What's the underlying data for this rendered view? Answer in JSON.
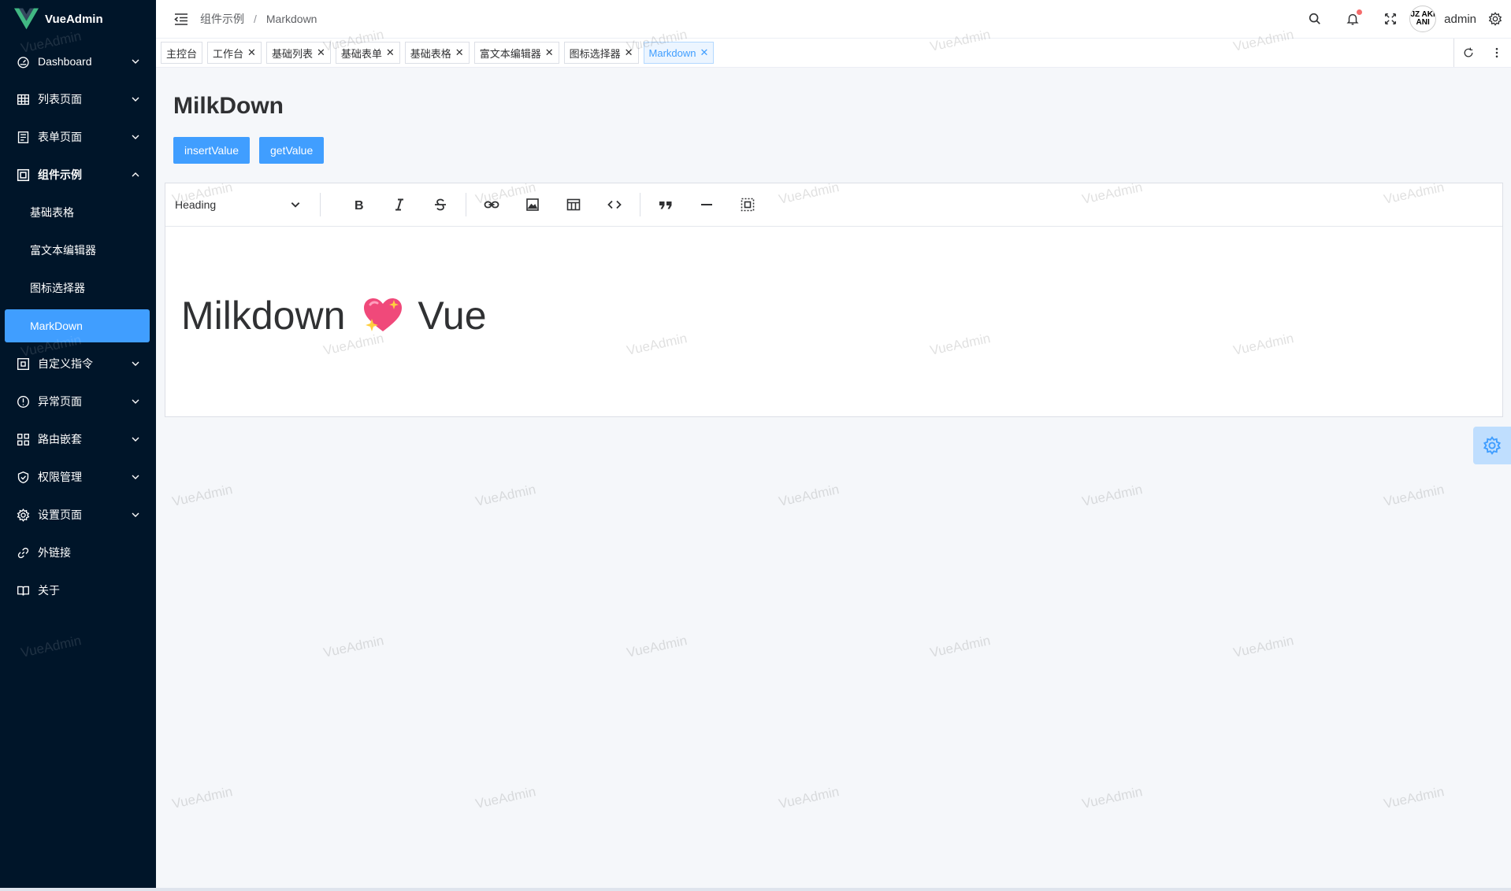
{
  "app": {
    "name": "VueAdmin",
    "brand_color": "#41b883",
    "accent": "#409eff",
    "sidebar_bg": "#001529"
  },
  "sidebar": {
    "items": [
      {
        "label": "Dashboard",
        "icon": "dashboard-icon",
        "has_children": true
      },
      {
        "label": "列表页面",
        "icon": "table-icon",
        "has_children": true
      },
      {
        "label": "表单页面",
        "icon": "form-icon",
        "has_children": true
      },
      {
        "label": "组件示例",
        "icon": "component-icon",
        "has_children": true,
        "open": true,
        "children": [
          {
            "label": "基础表格"
          },
          {
            "label": "富文本编辑器"
          },
          {
            "label": "图标选择器"
          },
          {
            "label": "MarkDown",
            "active": true
          }
        ]
      },
      {
        "label": "自定义指令",
        "icon": "command-icon",
        "has_children": true
      },
      {
        "label": "异常页面",
        "icon": "warning-icon",
        "has_children": true
      },
      {
        "label": "路由嵌套",
        "icon": "route-icon",
        "has_children": true
      },
      {
        "label": "权限管理",
        "icon": "shield-icon",
        "has_children": true
      },
      {
        "label": "设置页面",
        "icon": "gear-icon",
        "has_children": true
      },
      {
        "label": "外链接",
        "icon": "link-icon",
        "has_children": false
      },
      {
        "label": "关于",
        "icon": "book-icon",
        "has_children": false
      }
    ]
  },
  "header": {
    "breadcrumb": [
      "组件示例",
      "Markdown"
    ],
    "separator": "/",
    "username": "admin",
    "avatar_text": "JZ AKI ANI"
  },
  "tags": [
    {
      "label": "主控台",
      "closable": false
    },
    {
      "label": "工作台",
      "closable": true
    },
    {
      "label": "基础列表",
      "closable": true
    },
    {
      "label": "基础表单",
      "closable": true
    },
    {
      "label": "基础表格",
      "closable": true
    },
    {
      "label": "富文本编辑器",
      "closable": true
    },
    {
      "label": "图标选择器",
      "closable": true
    },
    {
      "label": "Markdown",
      "closable": true,
      "active": true
    }
  ],
  "page": {
    "title": "MilkDown",
    "buttons": {
      "insert": "insertValue",
      "get": "getValue"
    },
    "editor": {
      "heading_select": "Heading",
      "content_left": "Milkdown",
      "content_emoji": "sparkling-heart",
      "content_right": "Vue"
    }
  },
  "watermark": "VueAdmin"
}
